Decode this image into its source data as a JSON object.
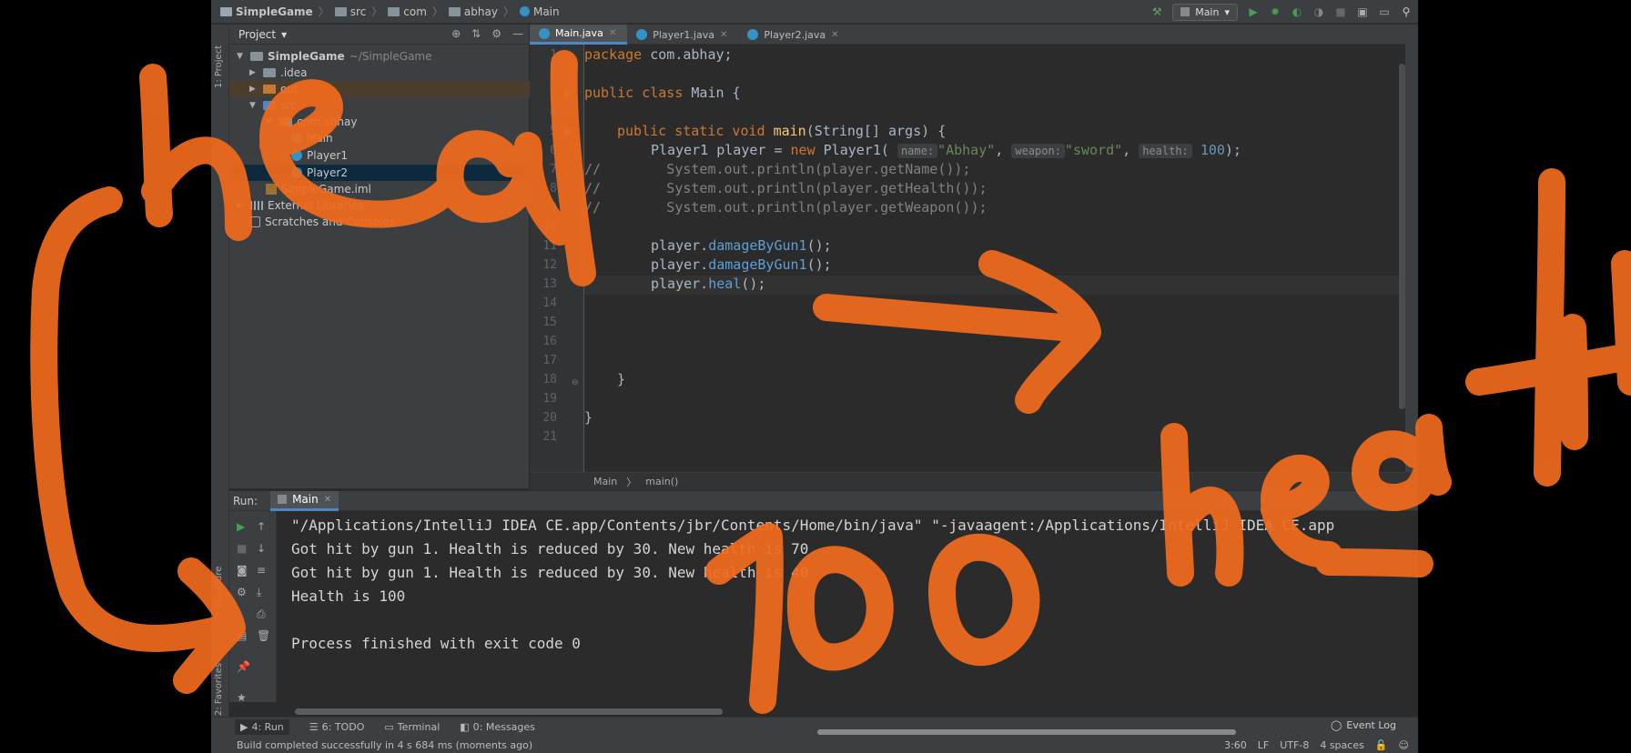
{
  "navbar": {
    "crumbs": [
      "SimpleGame",
      "src",
      "com",
      "abhay",
      "Main"
    ],
    "run_config": "Main"
  },
  "left_stripe": {
    "project_label": "1: Project",
    "structure_label": "7: Structure",
    "favorites_label": "2: Favorites"
  },
  "project_panel": {
    "title": "Project",
    "tree": [
      {
        "label": "SimpleGame",
        "suffix": "~/SimpleGame"
      },
      {
        "label": ".idea"
      },
      {
        "label": "out"
      },
      {
        "label": "src"
      },
      {
        "label": "com.abhay"
      },
      {
        "label": "Main"
      },
      {
        "label": "Player1"
      },
      {
        "label": "Player2"
      },
      {
        "label": "SimpleGame.iml"
      },
      {
        "label": "External Libraries"
      },
      {
        "label": "Scratches and Consoles"
      }
    ]
  },
  "editor": {
    "tabs": [
      "Main.java",
      "Player1.java",
      "Player2.java"
    ],
    "line_numbers": [
      "1",
      "2",
      "3",
      "4",
      "5",
      "6",
      "7",
      "8",
      "9",
      "10",
      "11",
      "12",
      "13",
      "14",
      "15",
      "16",
      "17",
      "18",
      "19",
      "20",
      "21"
    ],
    "lines": {
      "l1_kw": "package",
      "l1_rest": " com.abhay;",
      "l3_kw": "public class",
      "l3_rest": " Main {",
      "l5_kw": "public static void",
      "l5_m": "main",
      "l5_rest": "(String[] args) {",
      "l6_a": "Player1 player = ",
      "l6_new": "new",
      "l6_b": " Player1(",
      "l6_h1": "name:",
      "l6_s1": "\"Abhay\"",
      "l6_h2": "weapon:",
      "l6_s2": "\"sword\"",
      "l6_h3": "health:",
      "l6_n": "100",
      "l6_end": ");",
      "l7": "//        System.out.println(player.getName());",
      "l8": "//        System.out.println(player.getHealth());",
      "l9": "//        System.out.println(player.getWeapon());",
      "l11_a": "player.",
      "l11_m": "damageByGun1",
      "l11_b": "();",
      "l12_a": "player.",
      "l12_m": "damageByGun1",
      "l12_b": "();",
      "l13_a": "player.",
      "l13_m": "heal",
      "l13_b": "();",
      "l18": "}",
      "l20": "}"
    },
    "breadcrumb": [
      "Main",
      "main()"
    ]
  },
  "run_panel": {
    "label": "Run:",
    "tab": "Main",
    "console": [
      "\"/Applications/IntelliJ IDEA CE.app/Contents/jbr/Contents/Home/bin/java\" \"-javaagent:/Applications/IntelliJ IDEA CE.app",
      "Got hit by gun 1. Health is reduced by 30. New health is 70",
      "Got hit by gun 1. Health is reduced by 30. New health is 40",
      "Health is 100",
      "",
      "Process finished with exit code 0"
    ]
  },
  "tool_windows": [
    "4: Run",
    "6: TODO",
    "Terminal",
    "0: Messages"
  ],
  "event_log": "Event Log",
  "status": {
    "message": "Build completed successfully in 4 s 684 ms (moments ago)",
    "position": "3:60",
    "line_sep": "LF",
    "encoding": "UTF-8",
    "indent": "4 spaces"
  },
  "colors": {
    "annotation": "#f26b1d",
    "keyword": "#cc7832",
    "string": "#6a8759",
    "number": "#6897bb",
    "method": "#ffc66d"
  }
}
